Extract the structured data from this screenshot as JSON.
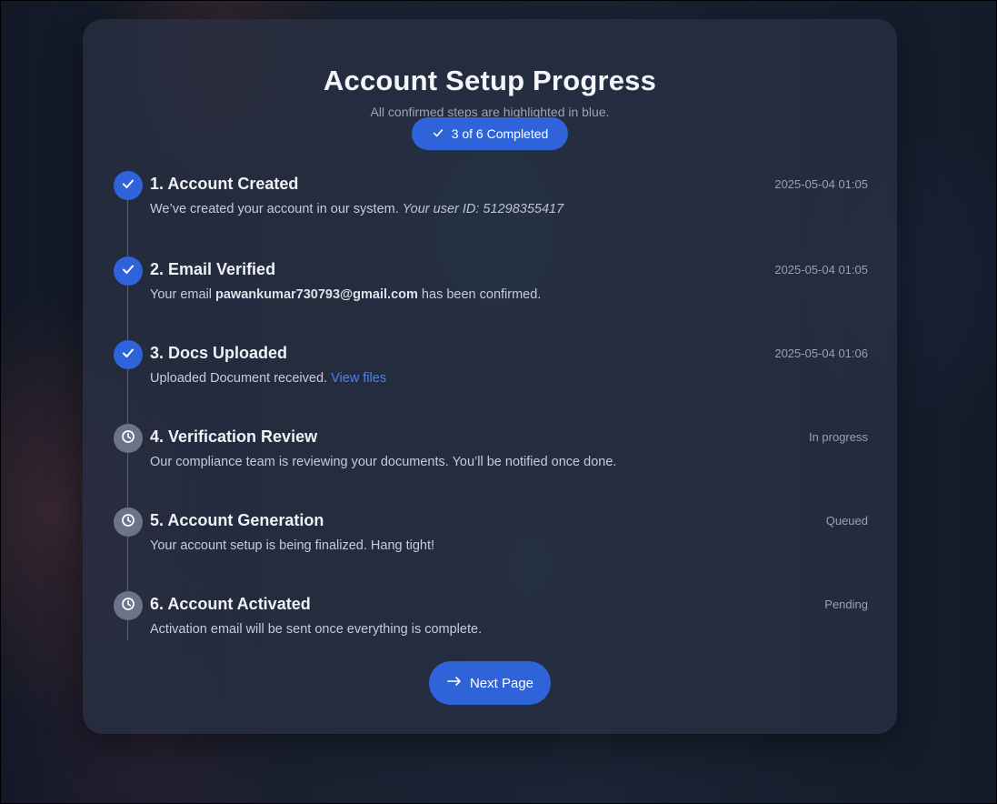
{
  "header": {
    "title": "Account Setup Progress",
    "subtitle": "All confirmed steps are highlighted in blue.",
    "badge_label": "3 of 6 Completed",
    "badge_icon": "check-icon"
  },
  "steps": [
    {
      "title": "1. Account Created",
      "time": "2025-05-04 01:05",
      "status": "completed",
      "icon": "check-icon",
      "desc_text": "We’ve created your account in our system. ",
      "desc_italic": "Your user ID: 51298355417"
    },
    {
      "title": "2. Email Verified",
      "time": "2025-05-04 01:05",
      "status": "completed",
      "icon": "check-icon",
      "desc_prefix": "Your email ",
      "desc_bold": "pawankumar730793@gmail.com",
      "desc_suffix": " has been confirmed."
    },
    {
      "title": "3. Docs Uploaded",
      "time": "2025-05-04 01:06",
      "status": "completed",
      "icon": "check-icon",
      "desc_text": "Uploaded Document received. ",
      "desc_link": "View files"
    },
    {
      "title": "4. Verification Review",
      "time": "In progress",
      "status": "pending",
      "icon": "clock-icon",
      "desc_text": "Our compliance team is reviewing your documents. You’ll be notified once done."
    },
    {
      "title": "5. Account Generation",
      "time": "Queued",
      "status": "pending",
      "icon": "clock-icon",
      "desc_text": "Your account setup is being finalized. Hang tight!"
    },
    {
      "title": "6. Account Activated",
      "time": "Pending",
      "status": "pending",
      "icon": "clock-icon",
      "desc_text": "Activation email will be sent once everything is complete."
    }
  ],
  "footer": {
    "next_label": "Next Page",
    "next_icon": "arrow-right-icon"
  },
  "colors": {
    "accent": "#2f63d9",
    "link": "#4e82ee",
    "pending_marker": "#6b7488",
    "card_background": "#283042"
  }
}
